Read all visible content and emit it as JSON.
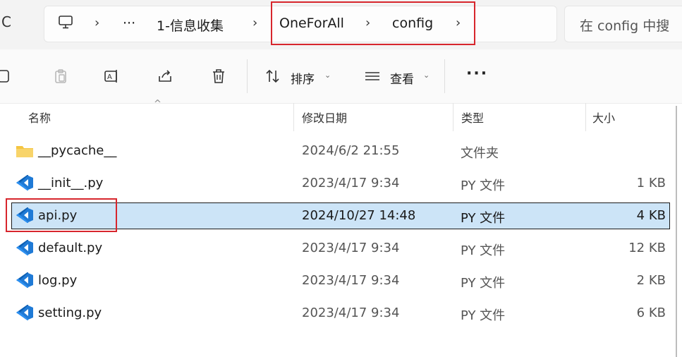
{
  "address": {
    "crumbs": [
      "1-信息收集",
      "OneForAll",
      "config"
    ],
    "ellipsis": "···",
    "separator": "›",
    "search_placeholder": "在 config 中搜"
  },
  "toolbar": {
    "sort_label": "排序",
    "view_label": "查看",
    "more_label": "···"
  },
  "columns": {
    "name": "名称",
    "modified": "修改日期",
    "type": "类型",
    "size": "大小"
  },
  "files": [
    {
      "name": "__pycache__",
      "modified": "2024/6/2 21:55",
      "type": "文件夹",
      "size": "",
      "icon": "folder-icon",
      "selected": false
    },
    {
      "name": "__init__.py",
      "modified": "2023/4/17 9:34",
      "type": "PY 文件",
      "size": "1 KB",
      "icon": "vscode-icon",
      "selected": false
    },
    {
      "name": "api.py",
      "modified": "2024/10/27 14:48",
      "type": "PY 文件",
      "size": "4 KB",
      "icon": "vscode-icon",
      "selected": true
    },
    {
      "name": "default.py",
      "modified": "2023/4/17 9:34",
      "type": "PY 文件",
      "size": "12 KB",
      "icon": "vscode-icon",
      "selected": false
    },
    {
      "name": "log.py",
      "modified": "2023/4/17 9:34",
      "type": "PY 文件",
      "size": "2 KB",
      "icon": "vscode-icon",
      "selected": false
    },
    {
      "name": "setting.py",
      "modified": "2023/4/17 9:34",
      "type": "PY 文件",
      "size": "6 KB",
      "icon": "vscode-icon",
      "selected": false
    }
  ],
  "colors": {
    "highlight_box": "#d7262d",
    "selected_row": "#cce4f7",
    "folder": "#f4c542",
    "vscode": "#1f7ad6"
  }
}
